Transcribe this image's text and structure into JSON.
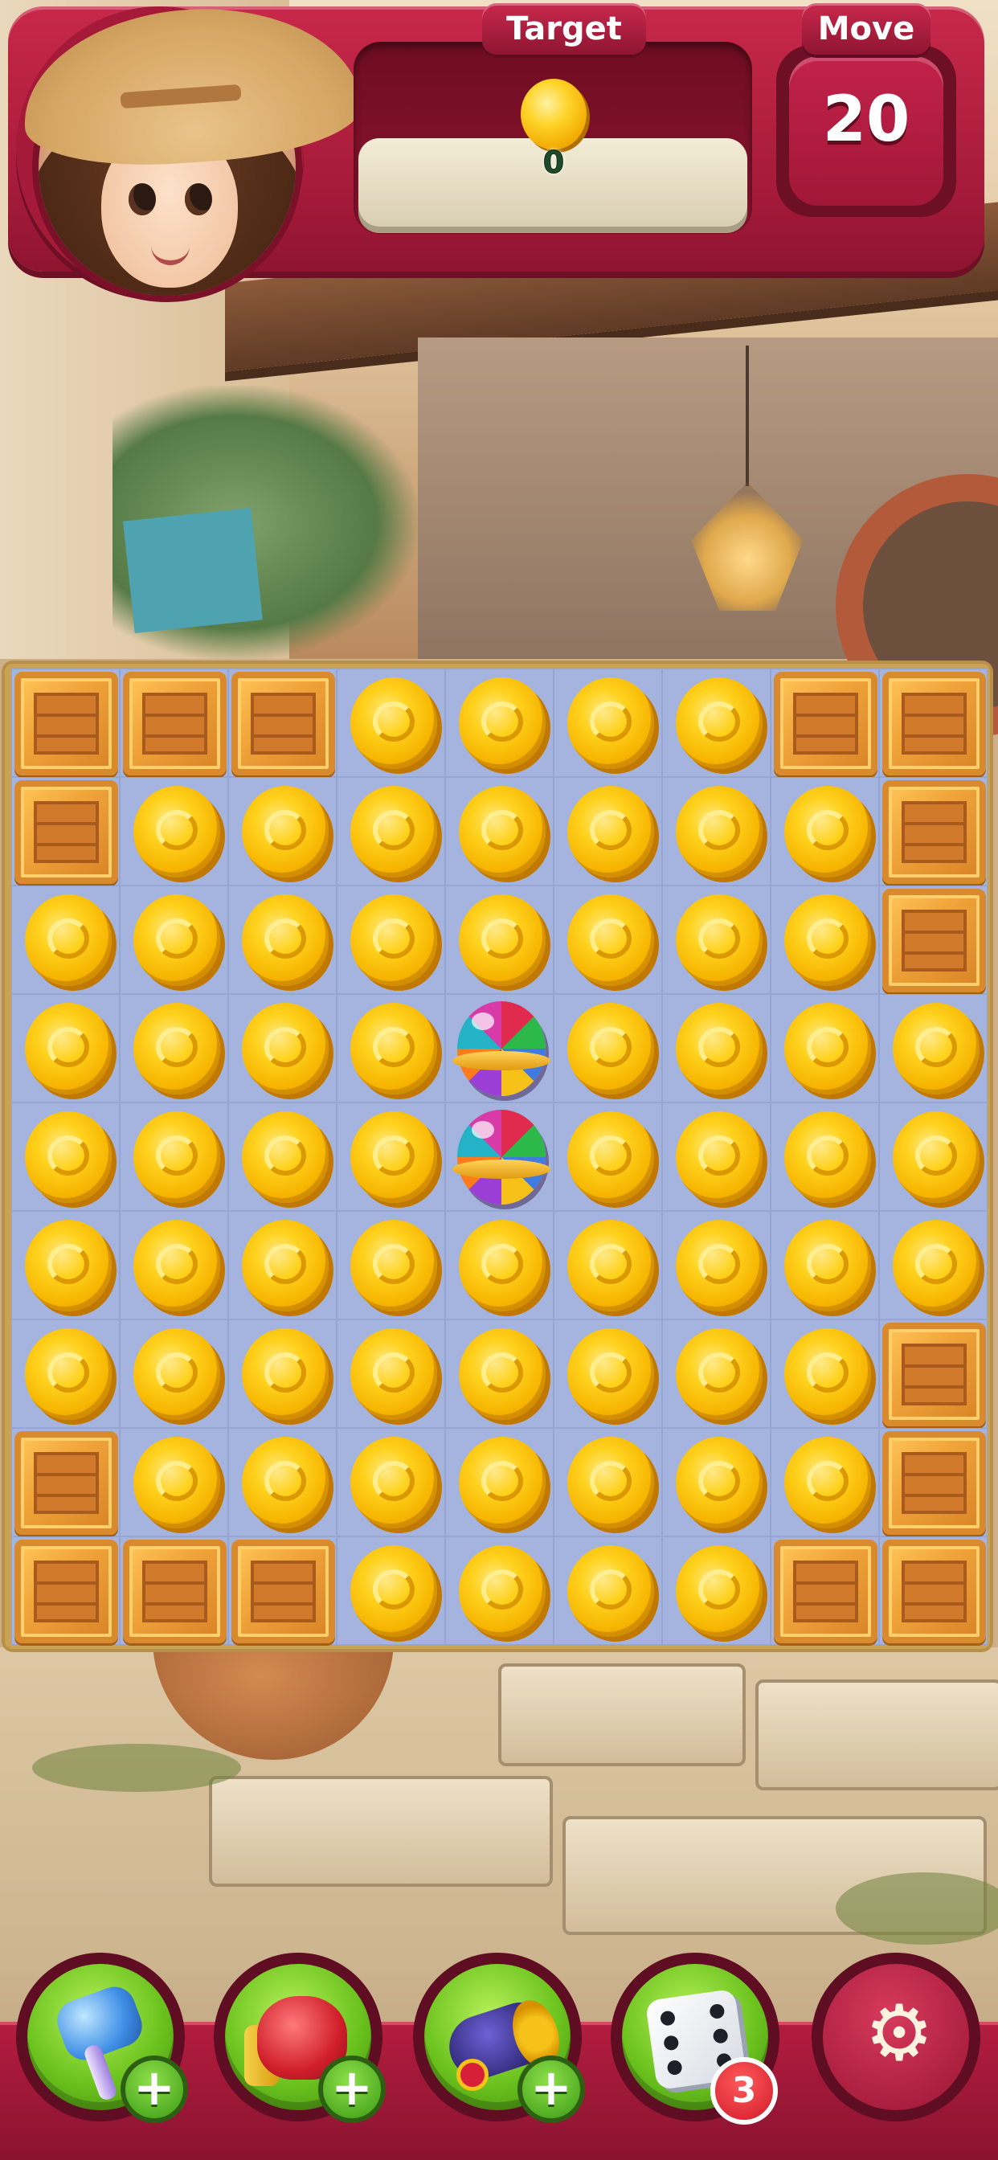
{
  "hud": {
    "target_label": "Target",
    "target_item": "coin",
    "target_count": "0",
    "move_label": "Move",
    "moves_left": "20",
    "character": "girl-with-straw-hat-avatar"
  },
  "board": {
    "rows": 9,
    "cols": 9,
    "legend": {
      "C": "gold-coin",
      "W": "wooden-crate",
      "R": "rainbow-disco-ball"
    },
    "grid": [
      [
        "W",
        "W",
        "W",
        "C",
        "C",
        "C",
        "C",
        "W",
        "W"
      ],
      [
        "W",
        "C",
        "C",
        "C",
        "C",
        "C",
        "C",
        "C",
        "W"
      ],
      [
        "C",
        "C",
        "C",
        "C",
        "C",
        "C",
        "C",
        "C",
        "W"
      ],
      [
        "C",
        "C",
        "C",
        "C",
        "R",
        "C",
        "C",
        "C",
        "C"
      ],
      [
        "C",
        "C",
        "C",
        "C",
        "R",
        "C",
        "C",
        "C",
        "C"
      ],
      [
        "C",
        "C",
        "C",
        "C",
        "C",
        "C",
        "C",
        "C",
        "C"
      ],
      [
        "C",
        "C",
        "C",
        "C",
        "C",
        "C",
        "C",
        "C",
        "W"
      ],
      [
        "W",
        "C",
        "C",
        "C",
        "C",
        "C",
        "C",
        "C",
        "W"
      ],
      [
        "W",
        "W",
        "W",
        "C",
        "C",
        "C",
        "C",
        "W",
        "W"
      ]
    ]
  },
  "boosters": [
    {
      "name": "hammer",
      "icon": "hammer-icon",
      "badge": "+"
    },
    {
      "name": "boxing-glove",
      "icon": "boxing-glove-icon",
      "badge": "+"
    },
    {
      "name": "cannon",
      "icon": "cannon-icon",
      "badge": "+"
    },
    {
      "name": "dice",
      "icon": "dice-icon",
      "badge": "3"
    }
  ],
  "settings": {
    "icon": "gear-icon",
    "glyph": "⚙"
  },
  "colors": {
    "hud_red": "#a51a39",
    "board_bg": "#a5b4de",
    "coin_gold": "#f6b400",
    "crate_orange": "#f0a43a",
    "booster_green": "#6cc31e"
  }
}
